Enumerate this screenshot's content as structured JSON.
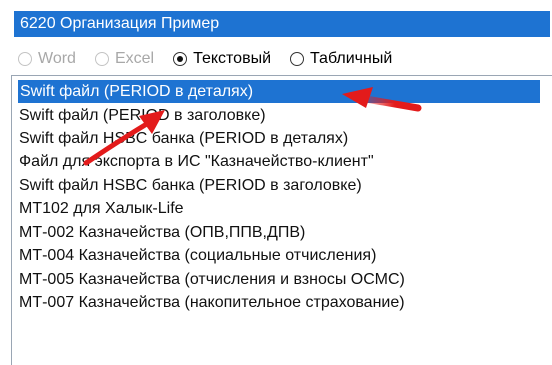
{
  "organization": {
    "value": "6220 Организация Пример"
  },
  "format_options": [
    {
      "label": "Word",
      "checked": false,
      "disabled": true
    },
    {
      "label": "Excel",
      "checked": false,
      "disabled": true
    },
    {
      "label": "Текстовый",
      "checked": true,
      "disabled": false
    },
    {
      "label": "Табличный",
      "checked": false,
      "disabled": false
    }
  ],
  "file_list": {
    "selected_index": 0,
    "items": [
      "Swift файл (PERIOD в деталях)",
      "Swift файл (PERIOD в заголовке)",
      "Swift файл HSBC банка (PERIOD в деталях)",
      "Файл для экспорта в ИС \"Казначейство-клиент\"",
      "Swift файл HSBC банка (PERIOD в заголовке)",
      "МТ102 для Халык-Life",
      "МТ-002 Казначейства (ОПВ,ППВ,ДПВ)",
      "МТ-004 Казначейства (социальные отчисления)",
      "МТ-005 Казначейства (отчисления и взносы ОСМС)",
      "МТ-007 Казначейства (накопительное страхование)"
    ]
  },
  "annotation_color": "#e31b1b",
  "selection_color": "#1e73d2"
}
